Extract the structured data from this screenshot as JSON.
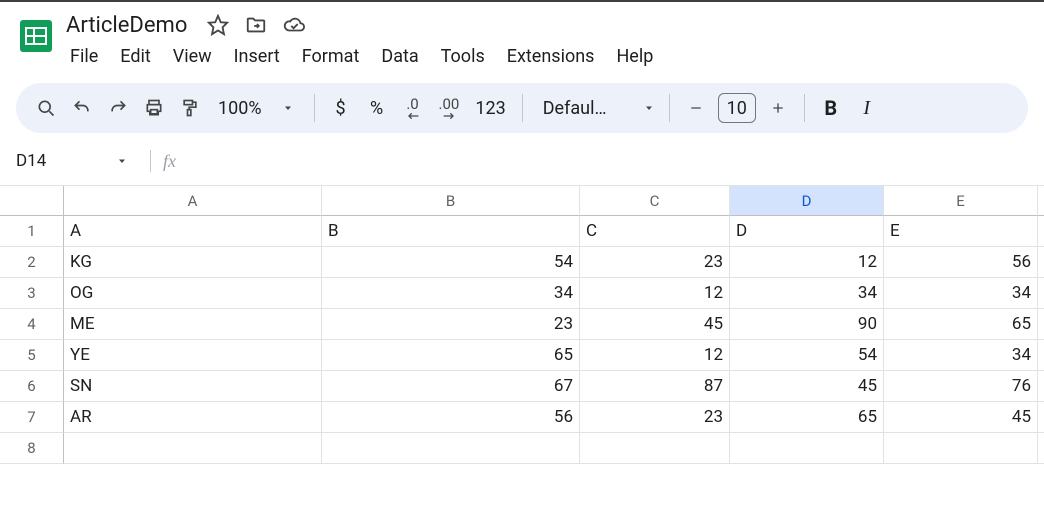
{
  "document": {
    "title": "ArticleDemo"
  },
  "menu": {
    "file": "File",
    "edit": "Edit",
    "view": "View",
    "insert": "Insert",
    "format": "Format",
    "data": "Data",
    "tools": "Tools",
    "extensions": "Extensions",
    "help": "Help"
  },
  "toolbar": {
    "zoom": "100%",
    "currency": "$",
    "percent": "%",
    "decrease_dec": ".0",
    "increase_dec": ".00",
    "more_formats": "123",
    "font_family": "Defaul…",
    "font_size": "10",
    "bold": "B",
    "italic": "I"
  },
  "namebox": {
    "ref": "D14",
    "formula": ""
  },
  "columns": {
    "A": "A",
    "B": "B",
    "C": "C",
    "D": "D",
    "E": "E",
    "selected": "D"
  },
  "row_labels": [
    "1",
    "2",
    "3",
    "4",
    "5",
    "6",
    "7",
    "8"
  ],
  "chart_data": {
    "type": "table",
    "columns": [
      "A",
      "B",
      "C",
      "D",
      "E"
    ],
    "rows": [
      {
        "A": "A",
        "B": "B",
        "C": "C",
        "D": "D",
        "E": "E"
      },
      {
        "A": "KG",
        "B": 54,
        "C": 23,
        "D": 12,
        "E": 56
      },
      {
        "A": "OG",
        "B": 34,
        "C": 12,
        "D": 34,
        "E": 34
      },
      {
        "A": "ME",
        "B": 23,
        "C": 45,
        "D": 90,
        "E": 65
      },
      {
        "A": "YE",
        "B": 65,
        "C": 12,
        "D": 54,
        "E": 34
      },
      {
        "A": "SN",
        "B": 67,
        "C": 87,
        "D": 45,
        "E": 76
      },
      {
        "A": "AR",
        "B": 56,
        "C": 23,
        "D": 65,
        "E": 45
      }
    ]
  }
}
